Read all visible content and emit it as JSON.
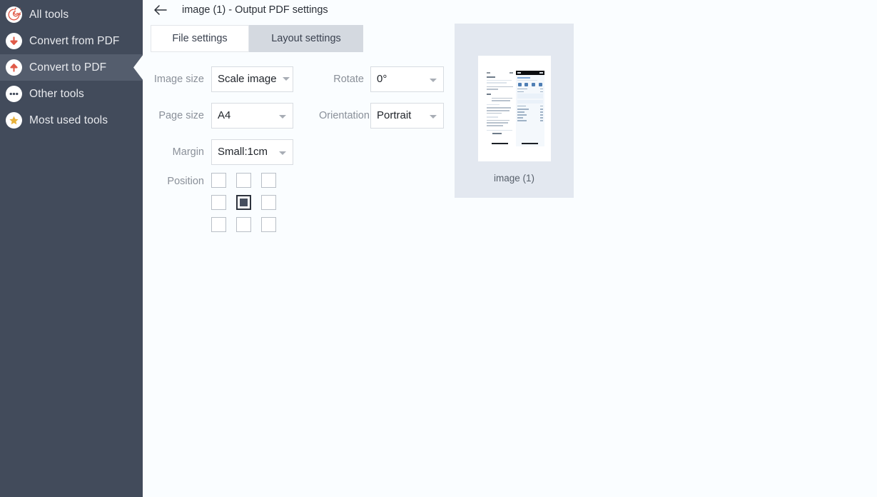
{
  "sidebar": {
    "items": [
      {
        "label": "All tools",
        "icon": "spiral-target-icon",
        "active": false
      },
      {
        "label": "Convert from PDF",
        "icon": "arrow-down-icon",
        "active": false
      },
      {
        "label": "Convert to PDF",
        "icon": "arrow-up-icon",
        "active": true
      },
      {
        "label": "Other tools",
        "icon": "ellipsis-icon",
        "active": false
      },
      {
        "label": "Most used tools",
        "icon": "star-icon",
        "active": false
      }
    ],
    "background_color": "#424b5b",
    "active_background_color": "#545d6d"
  },
  "header": {
    "back_icon": "arrow-left-icon",
    "title": "image (1) - Output PDF settings"
  },
  "tabs": [
    {
      "label": "File settings",
      "selected": true
    },
    {
      "label": "Layout settings",
      "selected": false
    }
  ],
  "form": {
    "image_size": {
      "label": "Image size",
      "value": "Scale image"
    },
    "rotate": {
      "label": "Rotate",
      "value": "0°"
    },
    "page_size": {
      "label": "Page size",
      "value": "A4"
    },
    "orientation": {
      "label": "Orientation",
      "value": "Portrait"
    },
    "margin": {
      "label": "Margin",
      "value": "Small:1cm"
    },
    "position": {
      "label": "Position",
      "selected_index": 4,
      "cells": [
        "top-left",
        "top-center",
        "top-right",
        "middle-left",
        "middle-center",
        "middle-right",
        "bottom-left",
        "bottom-center",
        "bottom-right"
      ]
    }
  },
  "preview": {
    "caption": "image (1)",
    "panel_color": "#e3e8f0"
  },
  "colors": {
    "accent_red": "#e05a48",
    "star_gold": "#e8b13a",
    "main_background": "#fafdff",
    "tab_inactive": "#d4d9e0"
  }
}
